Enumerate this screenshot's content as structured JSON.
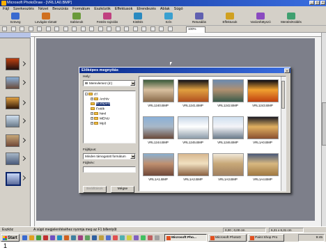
{
  "app": {
    "title": "Microsoft PhotoDraw - [VRL1A0.BMP]",
    "caption": "1"
  },
  "colors": {
    "titlebar": "#0a2a8a",
    "canvas": "#7d7f8a",
    "face": "#d4d0c8"
  },
  "menu": [
    "Fájl",
    "Szerkesztés",
    "Nézet",
    "Beszúrás",
    "Formátum",
    "Eszközök",
    "Effektusok",
    "Elrendezés",
    "Ablak",
    "Súgó"
  ],
  "big_toolbar": [
    {
      "label": "Szöveg",
      "icon": "text-icon"
    },
    {
      "label": "Levágás-rámatr",
      "icon": "crop-icon"
    },
    {
      "label": "Sablonok",
      "icon": "templates-icon"
    },
    {
      "label": "Festés-rajzolás",
      "icon": "paint-icon"
    },
    {
      "label": "Kitöltés",
      "icon": "fill-icon"
    },
    {
      "label": "Szín",
      "icon": "color-icon"
    },
    {
      "label": "Retusálás",
      "icon": "touchup-icon"
    },
    {
      "label": "Effektusok",
      "icon": "effects-icon"
    },
    {
      "label": "Varázsfüttyszó",
      "icon": "wizard-icon"
    },
    {
      "label": "Mentés/Küldés",
      "icon": "save-send-icon"
    }
  ],
  "toolbar": {
    "zoom": "100%"
  },
  "dialog": {
    "title": "Előképes megnyitás",
    "close": "×",
    "look_in_label": "Hely:",
    "look_in_value": "Merevlemez (d:)",
    "tree": [
      {
        "label": "d:\\",
        "depth": 0,
        "expander": "-"
      },
      {
        "label": "Archív",
        "depth": 1,
        "expander": "+"
      },
      {
        "label": "Budapest",
        "depth": 1,
        "expander": "",
        "selected": true
      },
      {
        "label": "Fotók",
        "depth": 1,
        "expander": ""
      },
      {
        "label": "html",
        "depth": 1,
        "expander": "+"
      },
      {
        "label": "MENU",
        "depth": 1,
        "expander": "+"
      },
      {
        "label": "Mp3",
        "depth": 1,
        "expander": "+"
      }
    ],
    "filetype_label": "Fájltípus:",
    "filetype_value": "Minden támogatott formátum",
    "filename_label": "Fájlnév:",
    "filename_value": "",
    "btn_options": "Beállítások",
    "btn_open": "Mégse",
    "files": [
      {
        "name": "VRL1240.BMP",
        "palette": [
          "#3a5a3a",
          "#8a6a4a",
          "#d8c0a0"
        ]
      },
      {
        "name": "VRL1241.BMP",
        "palette": [
          "#101018",
          "#b05020",
          "#e0a040"
        ]
      },
      {
        "name": "VRL1242.BMP",
        "palette": [
          "#6a8ab0",
          "#3a5a4a",
          "#b09070"
        ]
      },
      {
        "name": "VRL1243.BMP",
        "palette": [
          "#0a0a14",
          "#c04010",
          "#f0a030"
        ]
      },
      {
        "name": "VRL1244.BMP",
        "palette": [
          "#8ab0d8",
          "#6a4a3a",
          "#a8b8c8"
        ]
      },
      {
        "name": "VRL1245.BMP",
        "palette": [
          "#c8d8e8",
          "#8a9aa8",
          "#ffffff"
        ]
      },
      {
        "name": "VRL1246.BMP",
        "palette": [
          "#d0e0f0",
          "#6a7a8a",
          "#f4f4f8"
        ]
      },
      {
        "name": "VRL1A0.BMP",
        "palette": [
          "#1a1a24",
          "#8a5030",
          "#e0b060"
        ]
      },
      {
        "name": "VRL1A1.BMP",
        "palette": [
          "#8ab0d0",
          "#704838",
          "#c09070"
        ]
      },
      {
        "name": "VRL1A2.BMP",
        "palette": [
          "#d8b890",
          "#8a6040",
          "#f0e0c0"
        ]
      },
      {
        "name": "VRL1A3.BMP",
        "palette": [
          "#f0e8d8",
          "#a08060",
          "#c8a878"
        ]
      },
      {
        "name": "VRL1A4.BMP",
        "palette": [
          "#4a5a7a",
          "#a07840",
          "#d8b880"
        ]
      }
    ]
  },
  "statusbar": {
    "message": "A súgó megjelenítéséhez nyomja meg az F1 billentyűt",
    "left_label": "Eszköz",
    "pos": "0,00 ; 0,00 cm",
    "size": "6,21 x 6,31 cm"
  },
  "taskbar": {
    "start": "Start",
    "items": [
      {
        "label": "Microsoft Pho...",
        "active": true
      },
      {
        "label": "Microsoft PhotoD",
        "active": false
      },
      {
        "label": "Paint Shop Pro",
        "active": false
      }
    ],
    "clock": "9:45"
  }
}
